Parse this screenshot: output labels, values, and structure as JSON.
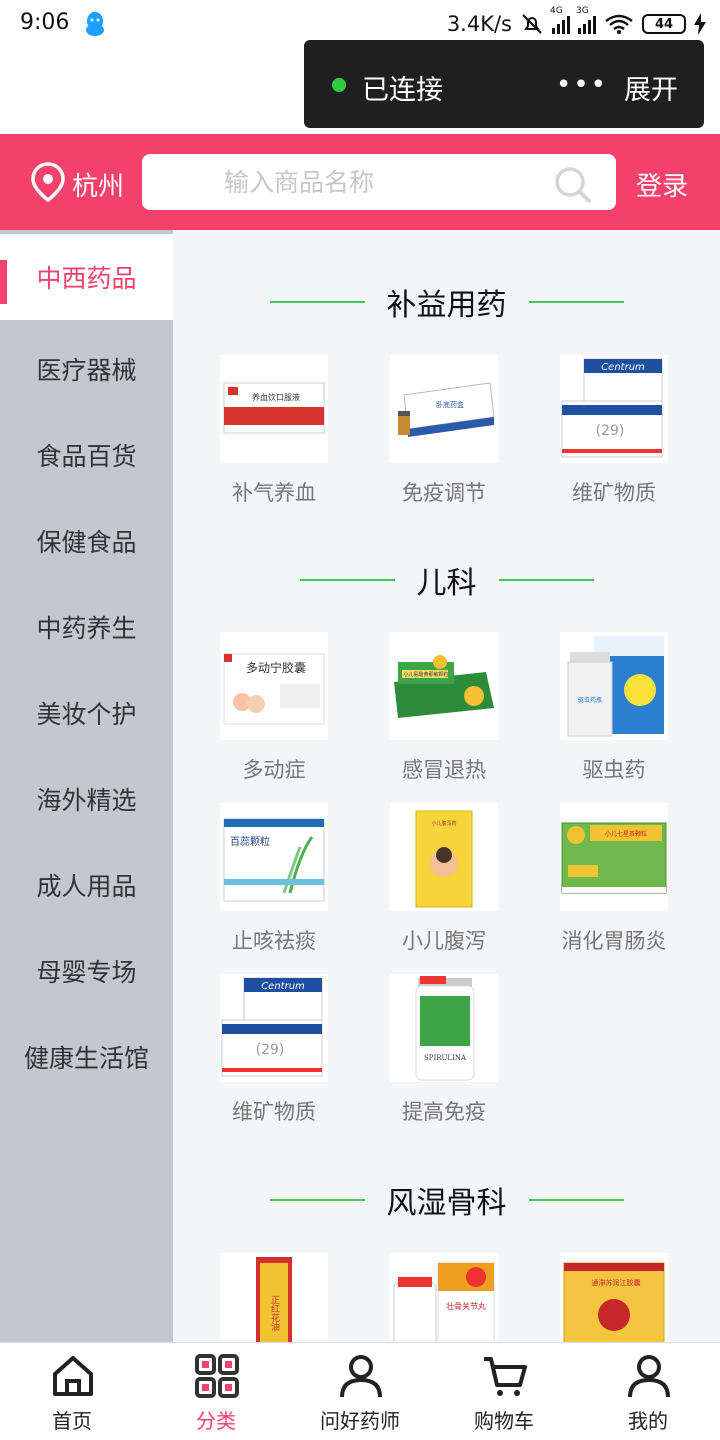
{
  "status_bar": {
    "time": "9:06",
    "speed": "3.4K/s",
    "net1": "4G",
    "net2": "3G",
    "battery": "44"
  },
  "overlay": {
    "status": "已连接",
    "more": "•••",
    "expand": "展开"
  },
  "header": {
    "city": "杭州",
    "search_placeholder": "输入商品名称",
    "login": "登录",
    "accent_color": "#f2426b"
  },
  "sidebar": {
    "items": [
      {
        "label": "中西药品",
        "active": true
      },
      {
        "label": "医疗器械"
      },
      {
        "label": "食品百货"
      },
      {
        "label": "保健食品"
      },
      {
        "label": "中药养生"
      },
      {
        "label": "美妆个护"
      },
      {
        "label": "海外精选"
      },
      {
        "label": "成人用品"
      },
      {
        "label": "母婴专场"
      },
      {
        "label": "健康生活馆"
      }
    ]
  },
  "sections": [
    {
      "title": "补益用药",
      "items": [
        {
          "label": "补气养血",
          "image": "养血饮口服液"
        },
        {
          "label": "免疫调节",
          "image": "卧底药盒"
        },
        {
          "label": "维矿物质",
          "image": "Centrum"
        }
      ]
    },
    {
      "title": "儿科",
      "items": [
        {
          "label": "多动症",
          "image": "多动宁胶囊"
        },
        {
          "label": "感冒退热",
          "image": "小儿氨酚黄那敏颗粒"
        },
        {
          "label": "驱虫药",
          "image": "驱虫药瓶"
        },
        {
          "label": "止咳祛痰",
          "image": "百蕊颗粒"
        },
        {
          "label": "小儿腹泻",
          "image": "小儿腹泻药"
        },
        {
          "label": "消化胃肠炎",
          "image": "小儿七星茶颗粒"
        },
        {
          "label": "维矿物质",
          "image": "Centrum"
        },
        {
          "label": "提高免疫",
          "image": "SPIRULINA"
        }
      ]
    },
    {
      "title": "风湿骨科",
      "items": [
        {
          "label": "",
          "image": "正红花油"
        },
        {
          "label": "",
          "image": "壮骨关节丸"
        },
        {
          "label": "",
          "image": "通滞苏润江胶囊"
        }
      ]
    }
  ],
  "tabbar": {
    "items": [
      {
        "label": "首页",
        "icon": "home-icon"
      },
      {
        "label": "分类",
        "icon": "category-icon",
        "active": true
      },
      {
        "label": "问好药师",
        "icon": "pharmacist-icon"
      },
      {
        "label": "购物车",
        "icon": "cart-icon"
      },
      {
        "label": "我的",
        "icon": "profile-icon"
      }
    ]
  }
}
